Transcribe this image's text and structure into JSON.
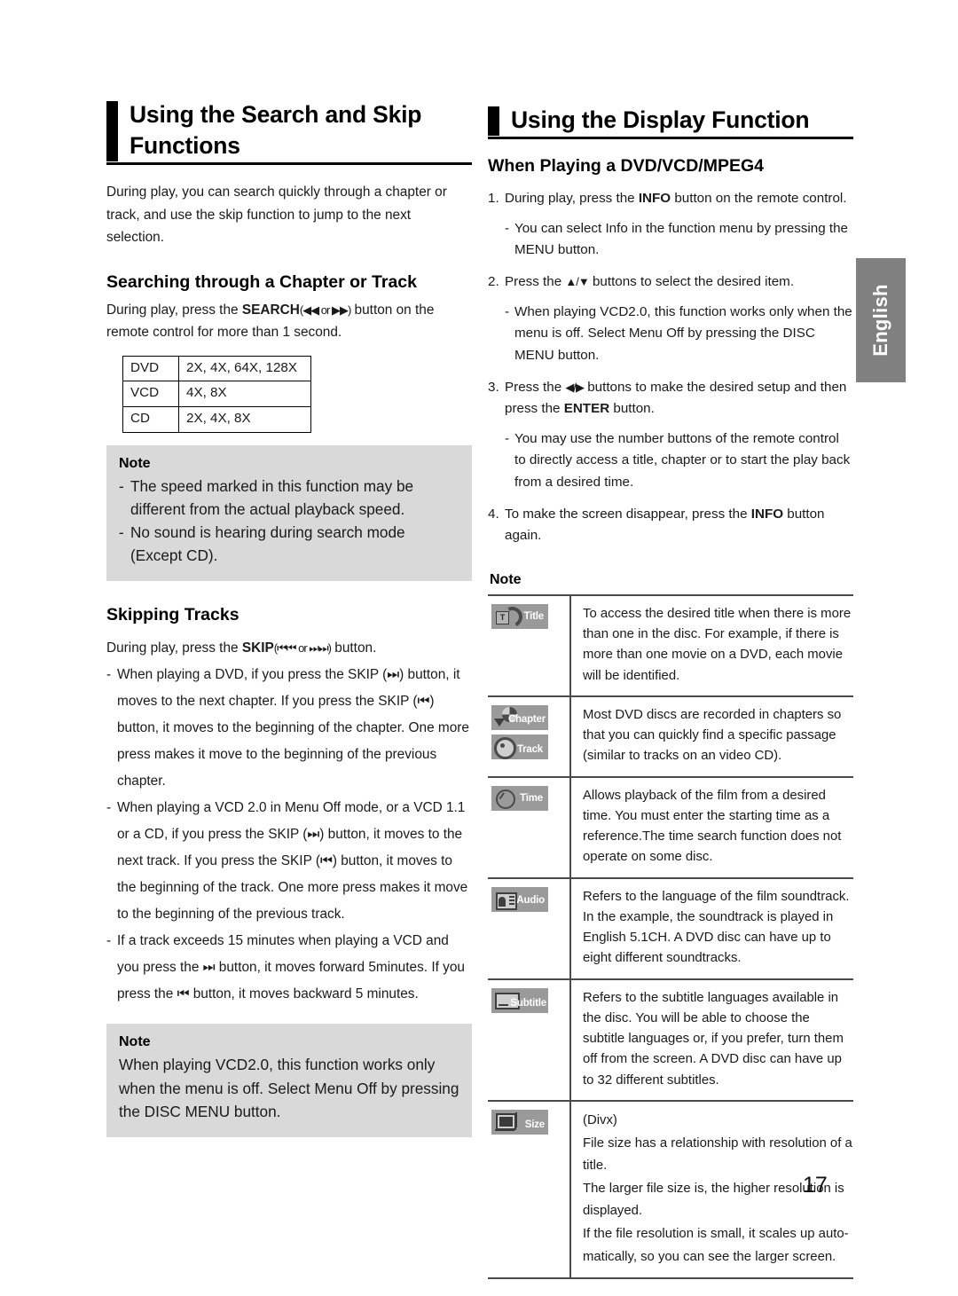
{
  "page": {
    "number": "17",
    "language_tab": "English"
  },
  "left_column": {
    "heading": "Using the Search and Skip Functions",
    "intro": "During play, you can search quickly through a chapter or track, and use the skip function to jump to the next selection.",
    "section_searching": {
      "heading": "Searching through a Chapter or Track",
      "body_before": "During play, press the ",
      "body_bold": "SEARCH",
      "body_icons": "(◀◀ or ▶▶)",
      "body_after": " button on the remote control for more than 1 second."
    },
    "speed_table": {
      "rows": [
        {
          "format": "DVD",
          "speeds": "2X, 4X, 64X, 128X"
        },
        {
          "format": "VCD",
          "speeds": "4X, 8X"
        },
        {
          "format": "CD",
          "speeds": "2X, 4X, 8X"
        }
      ]
    },
    "note_1": {
      "title": "Note",
      "items": [
        "The speed marked in this function may be different from the actual playback speed.",
        "No sound is hearing during search mode (Except CD)."
      ]
    },
    "section_skipping": {
      "heading": "Skipping Tracks",
      "lead_before": "During play, press the ",
      "lead_bold": "SKIP",
      "lead_icons": "(⏮⏮ or ⏭⏭)",
      "lead_after": " button.",
      "items": [
        "When playing a DVD, if you press the SKIP (⏭) button, it moves to the next chapter. If you press the SKIP (⏮) button, it moves to the beginning of the chapter. One more press makes it move to the beginning of the previous chapter.",
        "When playing a VCD 2.0 in Menu Off mode, or a VCD 1.1 or a CD, if you press the SKIP (⏭) button, it moves to the next track. If you press the SKIP (⏮) button, it moves to the beginning of the track. One more press makes it move to the beginning of the previous track.",
        "If a track exceeds 15 minutes when playing a VCD and you press the ⏭ button, it moves forward 5minutes. If you press the ⏮ button, it moves backward 5 minutes."
      ]
    },
    "note_2": {
      "title": "Note",
      "text": "When playing VCD2.0, this function works only when the menu is off. Select Menu Off by pressing the DISC MENU button."
    }
  },
  "right_column": {
    "heading": "Using the Display Function",
    "sub_heading": "When Playing a DVD/VCD/MPEG4",
    "steps": [
      {
        "num": "1.",
        "text_before": "During play, press the ",
        "text_bold": "INFO",
        "text_after": " button on the remote control.",
        "subitems": [
          "You can select Info in the function menu by pressing the MENU button."
        ]
      },
      {
        "num": "2.",
        "text_before": "Press the ",
        "text_bold": "",
        "text_icons": "▲/▼",
        "text_after": " buttons to select the desired item.",
        "subitems": [
          "When playing VCD2.0, this function works only when the menu is off. Select Menu Off by pressing the DISC MENU button."
        ]
      },
      {
        "num": "3.",
        "text_before": "Press the ",
        "text_icons": "◀/▶",
        "text_middle": " buttons to make the desired setup and then press the ",
        "text_bold": "ENTER",
        "text_after": " button.",
        "subitems": [
          "You may use the number buttons of the remote control to directly access a title, chapter or to start the play back from a desired time."
        ]
      },
      {
        "num": "4.",
        "text_before": "To make the screen disappear, press the ",
        "text_bold": "INFO",
        "text_after": " button again.",
        "subitems": []
      }
    ],
    "note_title": "Note",
    "icon_table": [
      {
        "badges": [
          {
            "name": "title-badge",
            "label": "Title"
          }
        ],
        "description": "To access the desired title when there is more than one in the disc. For example, if there is more than one movie on a DVD, each movie will be identified."
      },
      {
        "badges": [
          {
            "name": "chapter-badge",
            "label": "Chapter"
          },
          {
            "name": "track-badge",
            "label": "Track"
          }
        ],
        "description": "Most DVD discs are recorded in chapters so that you can quickly find a specific passage (similar to tracks on an video CD)."
      },
      {
        "badges": [
          {
            "name": "time-badge",
            "label": "Time"
          }
        ],
        "description": "Allows playback of the film from a desired time. You must enter the starting time as a reference.The time search function does not operate on some disc."
      },
      {
        "badges": [
          {
            "name": "audio-badge",
            "label": "Audio"
          }
        ],
        "description": "Refers to the language of the film soundtrack. In the example, the soundtrack is played in English 5.1CH. A DVD disc can have up to eight different soundtracks."
      },
      {
        "badges": [
          {
            "name": "subtitle-badge",
            "label": "Subtitle"
          }
        ],
        "description": "Refers to the subtitle languages available in the disc. You will be able to choose the subtitle languages or, if you prefer, turn them off from the screen. A DVD disc can have up to 32 different subtitles."
      },
      {
        "badges": [
          {
            "name": "size-badge",
            "label": "Size"
          }
        ],
        "description_lines": [
          "(Divx)",
          "File size has a relationship with resolution of a title.",
          "The larger file size is, the higher resolution is displayed.",
          "If the file resolution is small, it scales up auto-matically, so you can see the larger screen."
        ]
      }
    ]
  }
}
